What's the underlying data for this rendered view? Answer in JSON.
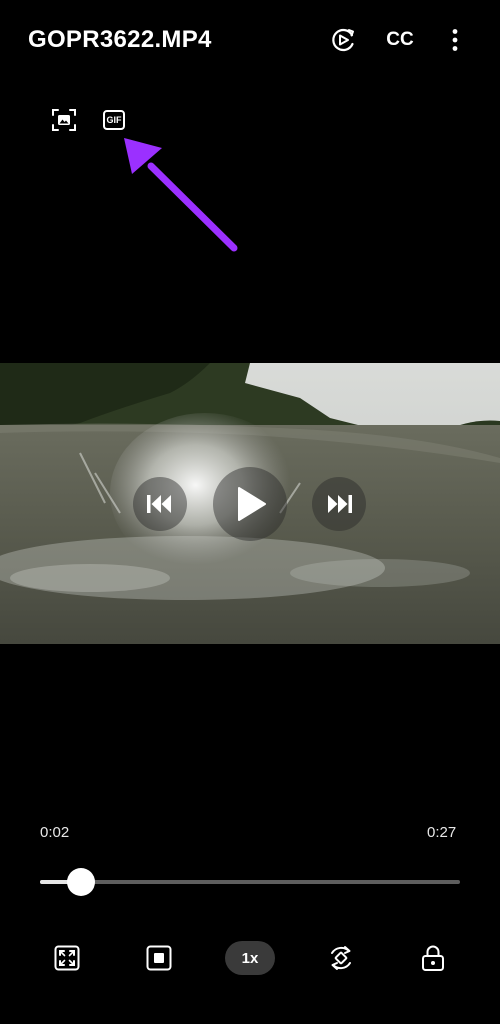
{
  "header": {
    "title": "GOPR3622.MP4",
    "cc_label": "CC"
  },
  "tools": {
    "gif_label": "GIF"
  },
  "player": {
    "current_time": "0:02",
    "total_time": "0:27",
    "progress": 0.098,
    "speed_label": "1x"
  },
  "icons": {
    "top": [
      "screen-share-icon",
      "more-vert-icon"
    ],
    "tools": [
      "capture-image-icon",
      "gif-icon"
    ],
    "controls": [
      "skip-previous-icon",
      "play-icon",
      "skip-next-icon"
    ],
    "bottom": [
      "fit-screen-icon",
      "stop-icon",
      "rotate-icon",
      "lock-icon"
    ]
  },
  "colors": {
    "background": "#000000",
    "annotation_arrow": "#9b30ff",
    "track": "#5e5e5e",
    "track_fill": "#e6e6e6"
  }
}
